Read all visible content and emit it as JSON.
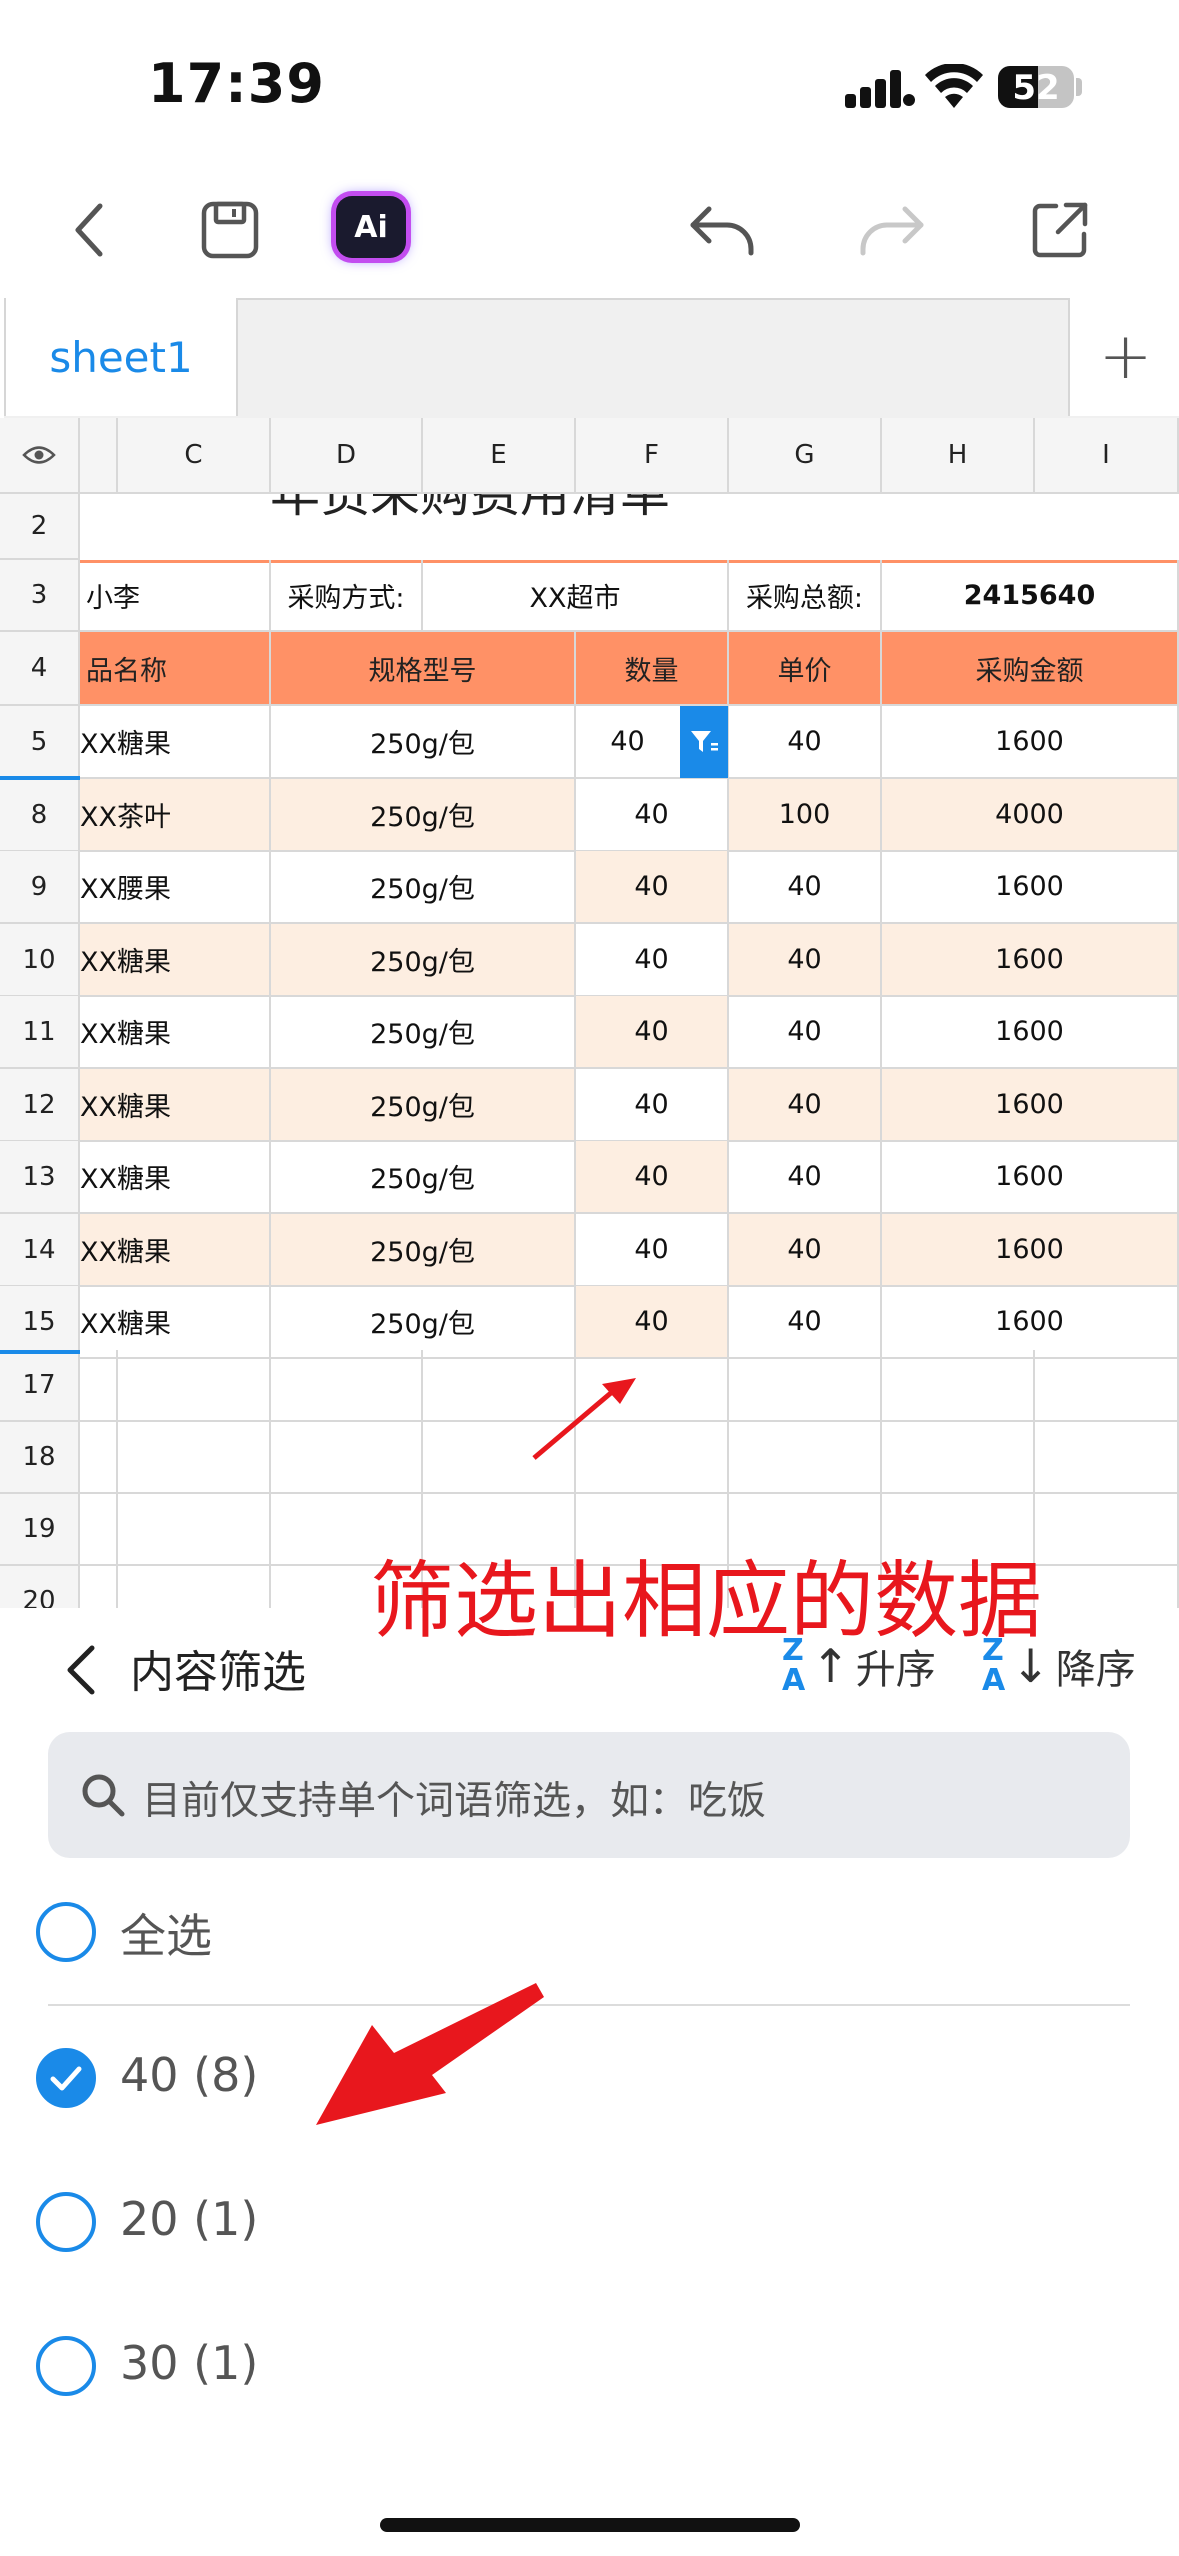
{
  "status_bar": {
    "time": "17:39",
    "battery": "52"
  },
  "toolbar": {
    "ai_label": "Ai",
    "icons": [
      "back-icon",
      "save-icon",
      "ai-icon",
      "undo-icon",
      "redo-icon",
      "share-icon"
    ]
  },
  "sheet_tab": {
    "name": "sheet1",
    "add": "+"
  },
  "columns": [
    "C",
    "D",
    "E",
    "F",
    "G",
    "H",
    "I"
  ],
  "row_headers": [
    "2",
    "3",
    "4",
    "5",
    "8",
    "9",
    "10",
    "11",
    "12",
    "13",
    "14",
    "15",
    "17",
    "18",
    "19",
    "20"
  ],
  "row2_title_fragment": "年货采购费用清单",
  "row3": {
    "name": "小李",
    "method_label": "采购方式:",
    "method_value": "XX超市",
    "total_label": "采购总额:",
    "total_value": "2415640"
  },
  "table_headers": [
    "品名称",
    "规格型号",
    "数量",
    "单价",
    "采购金额"
  ],
  "rows": [
    {
      "name": "XX糖果",
      "spec": "250g/包",
      "qty": "40",
      "price": "40",
      "amount": "1600"
    },
    {
      "name": "XX茶叶",
      "spec": "250g/包",
      "qty": "40",
      "price": "100",
      "amount": "4000"
    },
    {
      "name": "XX腰果",
      "spec": "250g/包",
      "qty": "40",
      "price": "40",
      "amount": "1600"
    },
    {
      "name": "XX糖果",
      "spec": "250g/包",
      "qty": "40",
      "price": "40",
      "amount": "1600"
    },
    {
      "name": "XX糖果",
      "spec": "250g/包",
      "qty": "40",
      "price": "40",
      "amount": "1600"
    },
    {
      "name": "XX糖果",
      "spec": "250g/包",
      "qty": "40",
      "price": "40",
      "amount": "1600"
    },
    {
      "name": "XX糖果",
      "spec": "250g/包",
      "qty": "40",
      "price": "40",
      "amount": "1600"
    },
    {
      "name": "XX糖果",
      "spec": "250g/包",
      "qty": "40",
      "price": "40",
      "amount": "1600"
    },
    {
      "name": "XX糖果",
      "spec": "250g/包",
      "qty": "40",
      "price": "40",
      "amount": "1600"
    }
  ],
  "annotation": "筛选出相应的数据",
  "filter_panel": {
    "title": "内容筛选",
    "sort_asc": "升序",
    "sort_desc": "降序",
    "search_placeholder": "目前仅支持单个词语筛选，如：吃饭",
    "select_all": "全选",
    "options": [
      {
        "label": "40 (8)",
        "checked": true
      },
      {
        "label": "20 (1)",
        "checked": false
      },
      {
        "label": "30 (1)",
        "checked": false
      }
    ]
  },
  "colors": {
    "accent": "#1a8ae8",
    "header_orange": "#ff9166",
    "row_peach": "#fdeee1",
    "annotation_red": "#e8171d"
  }
}
